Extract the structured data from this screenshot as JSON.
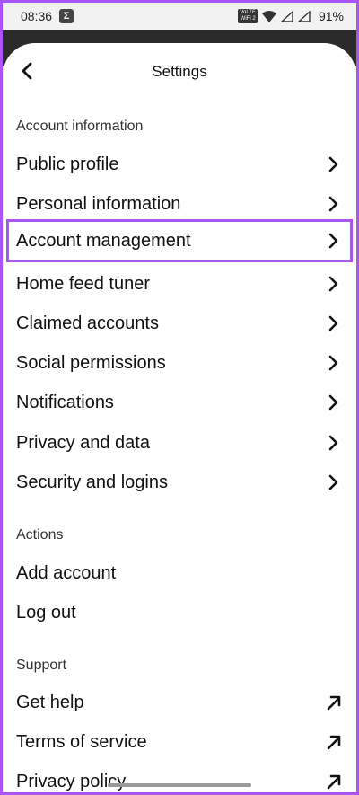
{
  "status_bar": {
    "time": "08:36",
    "notification_icon": "Σ",
    "network_badge_top": "VoLTE",
    "network_badge_bottom": "WiFi 2",
    "battery": "91%"
  },
  "header": {
    "title": "Settings",
    "back_icon": "chevron-left-icon"
  },
  "sections": {
    "account_information": {
      "label": "Account information",
      "items": [
        {
          "label": "Public profile"
        },
        {
          "label": "Personal information"
        },
        {
          "label": "Account management"
        },
        {
          "label": "Home feed tuner"
        },
        {
          "label": "Claimed accounts"
        },
        {
          "label": "Social permissions"
        },
        {
          "label": "Notifications"
        },
        {
          "label": "Privacy and data"
        },
        {
          "label": "Security and logins"
        }
      ]
    },
    "actions": {
      "label": "Actions",
      "items": [
        {
          "label": "Add account"
        },
        {
          "label": "Log out"
        }
      ]
    },
    "support": {
      "label": "Support",
      "items": [
        {
          "label": "Get help"
        },
        {
          "label": "Terms of service"
        },
        {
          "label": "Privacy policy"
        }
      ]
    }
  },
  "colors": {
    "highlight": "#a855f7"
  }
}
